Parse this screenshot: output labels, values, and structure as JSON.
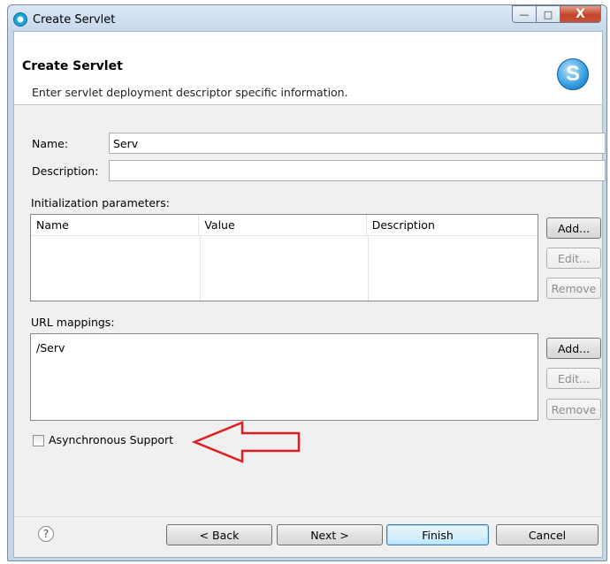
{
  "window": {
    "title": "Create Servlet",
    "controls": {
      "minimize": "—",
      "maximize": "□",
      "close": "X"
    }
  },
  "header": {
    "title": "Create Servlet",
    "description": "Enter servlet deployment descriptor specific information.",
    "logo_letter": "S"
  },
  "form": {
    "name_label": "Name:",
    "name_value": "Serv",
    "description_label": "Description:",
    "description_value": ""
  },
  "init_params": {
    "label": "Initialization parameters:",
    "columns": [
      "Name",
      "Value",
      "Description"
    ],
    "rows": [],
    "add_label": "Add...",
    "edit_label": "Edit...",
    "remove_label": "Remove"
  },
  "url_mappings": {
    "label": "URL mappings:",
    "items": [
      "/Serv"
    ],
    "add_label": "Add...",
    "edit_label": "Edit...",
    "remove_label": "Remove"
  },
  "async": {
    "label": "Asynchronous Support",
    "checked": false,
    "arrow_color": "#e02020"
  },
  "footer": {
    "help_symbol": "?",
    "back_label": "< Back",
    "next_label": "Next >",
    "finish_label": "Finish",
    "cancel_label": "Cancel"
  }
}
